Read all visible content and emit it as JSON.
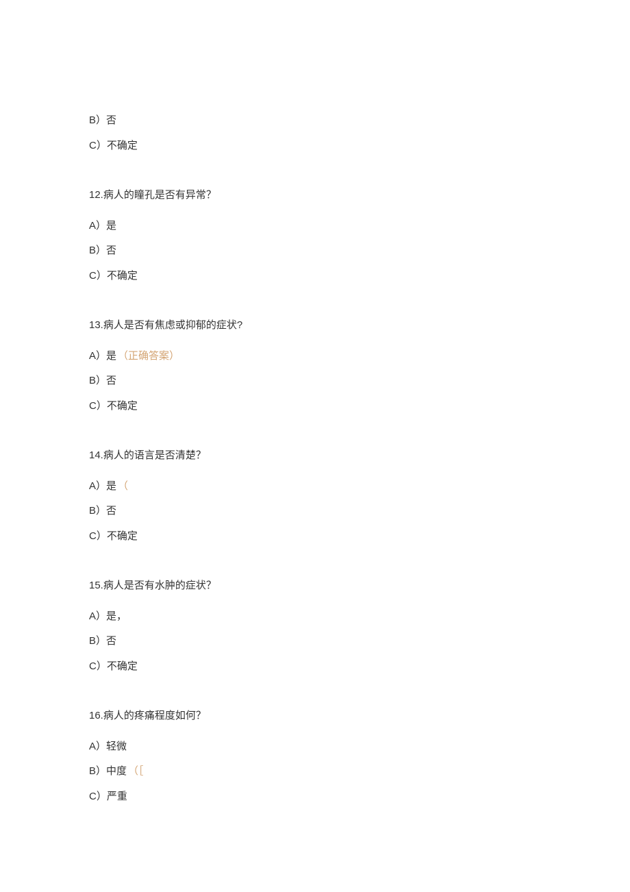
{
  "orphan_options": [
    {
      "label": "B）否"
    },
    {
      "label": "C）不确定"
    }
  ],
  "questions": [
    {
      "number": "12.",
      "text": "病人的瞳孔是否有异常？",
      "options": [
        {
          "label": "A）是"
        },
        {
          "label": "B）否"
        },
        {
          "label": "C）不确定"
        }
      ]
    },
    {
      "number": "13.",
      "text": "病人是否有焦虑或抑郁的症状?",
      "options": [
        {
          "label": "A）是",
          "marker": "（正确答案）",
          "marker_class": "correct-answer"
        },
        {
          "label": "B）否"
        },
        {
          "label": "C）不确定"
        }
      ]
    },
    {
      "number": "14.",
      "text": "病人的语言是否清楚？",
      "options": [
        {
          "label": "A）是",
          "marker": "（",
          "marker_class": "partial-marker"
        },
        {
          "label": "B）否"
        },
        {
          "label": "C）不确定"
        }
      ]
    },
    {
      "number": "15.",
      "text": "病人是否有水肿的症状？",
      "options": [
        {
          "label": "A）是，"
        },
        {
          "label": "B）否"
        },
        {
          "label": "C）不确定"
        }
      ]
    },
    {
      "number": "16.",
      "text": "病人的疼痛程度如何？",
      "options": [
        {
          "label": "A）轻微"
        },
        {
          "label": "B）中度",
          "marker": "（［",
          "marker_class": "partial-marker"
        },
        {
          "label": "C）严重"
        }
      ]
    }
  ]
}
